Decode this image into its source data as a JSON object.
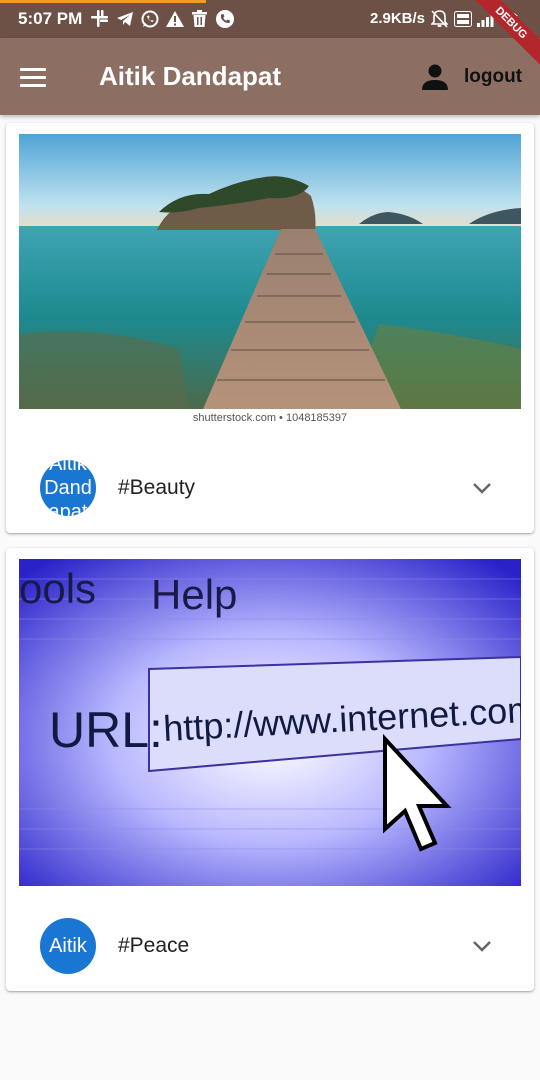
{
  "status_bar": {
    "time": "5:07 PM",
    "network_speed": "2.9KB/s",
    "left_icons": [
      "slack-icon",
      "telegram-icon",
      "whatsapp-icon",
      "warning-icon",
      "trash-icon",
      "phone-icon"
    ],
    "right_icons": [
      "bell-off-icon",
      "volte-icon",
      "signal-icon",
      "wifi-icon"
    ],
    "progress_color": "#f39a2b"
  },
  "debug_banner": "DEBUG",
  "app_bar": {
    "title": "Aitik Dandapat",
    "logout_label": "logout",
    "background": "#8d6e63"
  },
  "posts": [
    {
      "photo_caption": "shutterstock.com • 1048185397",
      "avatar_text": "Aitik Dandapat",
      "hashtag": "#Beauty"
    },
    {
      "photo_text": {
        "menu_tools": "ools",
        "menu_help": "Help",
        "url_label": "URL:",
        "url": "http://www.internet.com"
      },
      "avatar_text": "Aitik",
      "hashtag": "#Peace"
    }
  ],
  "colors": {
    "avatar": "#1976d2",
    "status_bar": "#6d5146"
  }
}
